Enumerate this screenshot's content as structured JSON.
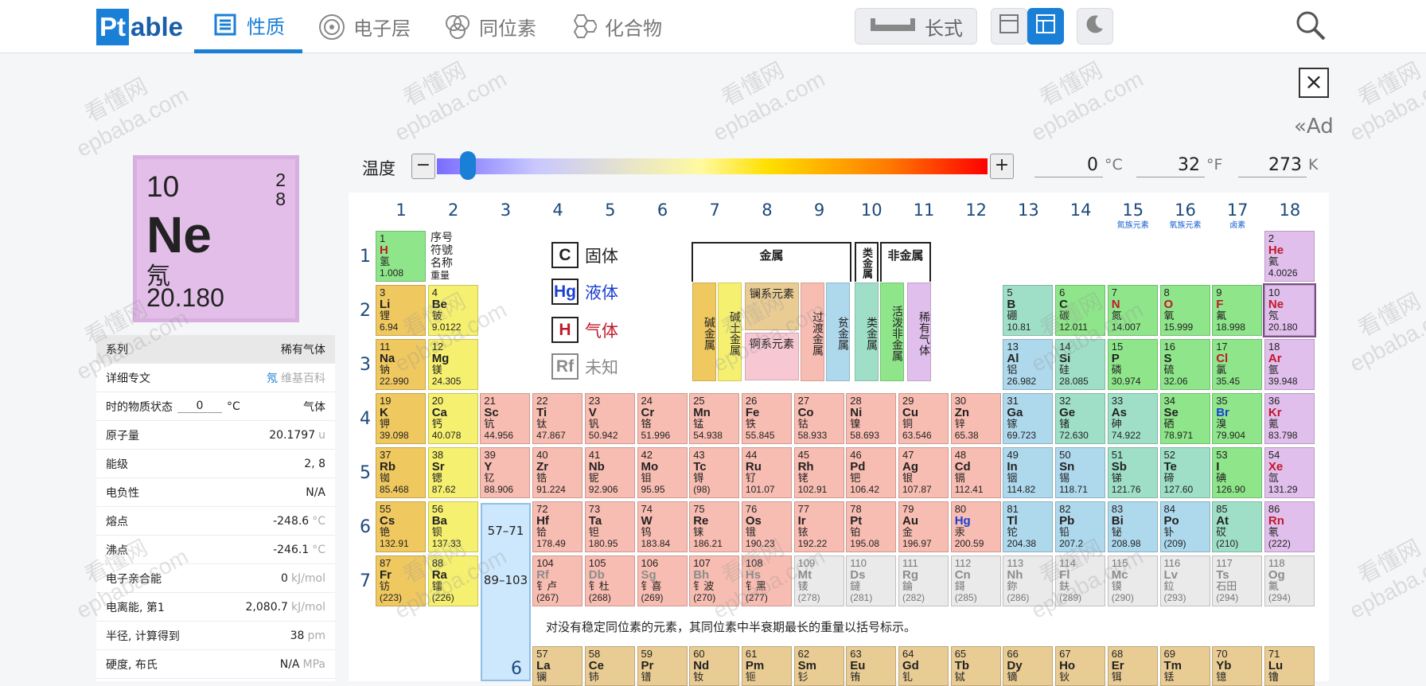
{
  "nav": {
    "logo_a": "Pt",
    "logo_b": "able",
    "tabs": [
      "性质",
      "电子层",
      "同位素",
      "化合物"
    ],
    "layout_label": "长式"
  },
  "ad": "«Ad",
  "card": {
    "number": "10",
    "shells": [
      "2",
      "8"
    ],
    "symbol": "Ne",
    "name": "氖",
    "mass": "20.180"
  },
  "props": [
    {
      "label": "系列",
      "value": "稀有气体",
      "hdr": true
    },
    {
      "label": "详细专文",
      "link": "氖",
      "value": "维基百科"
    },
    {
      "label": "时的物质状态",
      "temp": "0",
      "tunit": "°C",
      "value": "气体"
    },
    {
      "label": "原子量",
      "value": "20.1797",
      "unit": "u"
    },
    {
      "label": "能级",
      "value": "2, 8"
    },
    {
      "label": "电负性",
      "value": "N/A"
    },
    {
      "label": "熔点",
      "value": "-248.6",
      "unit": "°C"
    },
    {
      "label": "沸点",
      "value": "-246.1",
      "unit": "°C"
    },
    {
      "label": "电子亲合能",
      "value": "0",
      "unit": "kJ/mol"
    },
    {
      "label": "电离能, 第1",
      "value": "2,080.7",
      "unit": "kJ/mol"
    },
    {
      "label": "半径, 计算得到",
      "value": "38",
      "unit": "pm"
    },
    {
      "label": "硬度, 布氏",
      "value": "N/A",
      "unit": "MPa"
    }
  ],
  "temperature": {
    "label": "温度",
    "c": "0",
    "f": "32",
    "k": "273",
    "cu": "°C",
    "fu": "°F",
    "ku": "K"
  },
  "groups": [
    "1",
    "2",
    "3",
    "4",
    "5",
    "6",
    "7",
    "8",
    "9",
    "10",
    "11",
    "12",
    "13",
    "14",
    "15",
    "16",
    "17",
    "18"
  ],
  "group_sub": {
    "15": "氮族元素",
    "16": "氧族元素",
    "17": "卤素"
  },
  "periods": [
    "1",
    "2",
    "3",
    "4",
    "5",
    "6",
    "7"
  ],
  "key": [
    "序号",
    "符號",
    "名称",
    "重量"
  ],
  "legend": [
    {
      "sym": "C",
      "label": "固体"
    },
    {
      "sym": "Hg",
      "label": "液体"
    },
    {
      "sym": "H",
      "label": "气体"
    },
    {
      "sym": "Rf",
      "label": "未知"
    }
  ],
  "cat_headers": {
    "metal": "金属",
    "metalloid": "类金属",
    "nonmetal": "非金属"
  },
  "categories": [
    "碱金属",
    "碱土金属",
    "过渡金属",
    "贫金属",
    "类金属",
    "活泼非金属",
    "稀有气体"
  ],
  "lanth_label": "镧系元素",
  "actin_label": "锕系元素",
  "lanact": [
    "57–71",
    "89–103"
  ],
  "note": "对没有稳定同位素的元素，其同位素中半衰期最长的重量以括号标示。",
  "period6_label": "6",
  "watermark": [
    "看懂网",
    "epbaba.com"
  ],
  "elements": [
    [
      1,
      "H",
      "氢",
      "1.008",
      1,
      1,
      "nm",
      "g"
    ],
    [
      2,
      "He",
      "氦",
      "4.0026",
      18,
      1,
      "ng",
      "g"
    ],
    [
      3,
      "Li",
      "锂",
      "6.94",
      1,
      2,
      "alk",
      ""
    ],
    [
      4,
      "Be",
      "铍",
      "9.0122",
      2,
      2,
      "ae",
      ""
    ],
    [
      5,
      "B",
      "硼",
      "10.81",
      13,
      2,
      "met",
      ""
    ],
    [
      6,
      "C",
      "碳",
      "12.011",
      14,
      2,
      "nm",
      ""
    ],
    [
      7,
      "N",
      "氮",
      "14.007",
      15,
      2,
      "nm",
      "g"
    ],
    [
      8,
      "O",
      "氧",
      "15.999",
      16,
      2,
      "nm",
      "g"
    ],
    [
      9,
      "F",
      "氟",
      "18.998",
      17,
      2,
      "nm",
      "g"
    ],
    [
      10,
      "Ne",
      "氖",
      "20.180",
      18,
      2,
      "ng",
      "g"
    ],
    [
      11,
      "Na",
      "钠",
      "22.990",
      1,
      3,
      "alk",
      ""
    ],
    [
      12,
      "Mg",
      "镁",
      "24.305",
      2,
      3,
      "ae",
      ""
    ],
    [
      13,
      "Al",
      "铝",
      "26.982",
      13,
      3,
      "pt",
      ""
    ],
    [
      14,
      "Si",
      "硅",
      "28.085",
      14,
      3,
      "met",
      ""
    ],
    [
      15,
      "P",
      "磷",
      "30.974",
      15,
      3,
      "nm",
      ""
    ],
    [
      16,
      "S",
      "硫",
      "32.06",
      16,
      3,
      "nm",
      ""
    ],
    [
      17,
      "Cl",
      "氯",
      "35.45",
      17,
      3,
      "nm",
      "g"
    ],
    [
      18,
      "Ar",
      "氩",
      "39.948",
      18,
      3,
      "ng",
      "g"
    ],
    [
      19,
      "K",
      "钾",
      "39.098",
      1,
      4,
      "alk",
      ""
    ],
    [
      20,
      "Ca",
      "钙",
      "40.078",
      2,
      4,
      "ae",
      ""
    ],
    [
      21,
      "Sc",
      "钪",
      "44.956",
      3,
      4,
      "tm",
      ""
    ],
    [
      22,
      "Ti",
      "钛",
      "47.867",
      4,
      4,
      "tm",
      ""
    ],
    [
      23,
      "V",
      "钒",
      "50.942",
      5,
      4,
      "tm",
      ""
    ],
    [
      24,
      "Cr",
      "铬",
      "51.996",
      6,
      4,
      "tm",
      ""
    ],
    [
      25,
      "Mn",
      "锰",
      "54.938",
      7,
      4,
      "tm",
      ""
    ],
    [
      26,
      "Fe",
      "铁",
      "55.845",
      8,
      4,
      "tm",
      ""
    ],
    [
      27,
      "Co",
      "钴",
      "58.933",
      9,
      4,
      "tm",
      ""
    ],
    [
      28,
      "Ni",
      "镍",
      "58.693",
      10,
      4,
      "tm",
      ""
    ],
    [
      29,
      "Cu",
      "铜",
      "63.546",
      11,
      4,
      "tm",
      ""
    ],
    [
      30,
      "Zn",
      "锌",
      "65.38",
      12,
      4,
      "tm",
      ""
    ],
    [
      31,
      "Ga",
      "镓",
      "69.723",
      13,
      4,
      "pt",
      ""
    ],
    [
      32,
      "Ge",
      "锗",
      "72.630",
      14,
      4,
      "met",
      ""
    ],
    [
      33,
      "As",
      "砷",
      "74.922",
      15,
      4,
      "met",
      ""
    ],
    [
      34,
      "Se",
      "硒",
      "78.971",
      16,
      4,
      "nm",
      ""
    ],
    [
      35,
      "Br",
      "溴",
      "79.904",
      17,
      4,
      "nm",
      "l"
    ],
    [
      36,
      "Kr",
      "氪",
      "83.798",
      18,
      4,
      "ng",
      "g"
    ],
    [
      37,
      "Rb",
      "铷",
      "85.468",
      1,
      5,
      "alk",
      ""
    ],
    [
      38,
      "Sr",
      "锶",
      "87.62",
      2,
      5,
      "ae",
      ""
    ],
    [
      39,
      "Y",
      "钇",
      "88.906",
      3,
      5,
      "tm",
      ""
    ],
    [
      40,
      "Zr",
      "锆",
      "91.224",
      4,
      5,
      "tm",
      ""
    ],
    [
      41,
      "Nb",
      "铌",
      "92.906",
      5,
      5,
      "tm",
      ""
    ],
    [
      42,
      "Mo",
      "钼",
      "95.95",
      6,
      5,
      "tm",
      ""
    ],
    [
      43,
      "Tc",
      "锝",
      "(98)",
      7,
      5,
      "tm",
      ""
    ],
    [
      44,
      "Ru",
      "钌",
      "101.07",
      8,
      5,
      "tm",
      ""
    ],
    [
      45,
      "Rh",
      "铑",
      "102.91",
      9,
      5,
      "tm",
      ""
    ],
    [
      46,
      "Pd",
      "钯",
      "106.42",
      10,
      5,
      "tm",
      ""
    ],
    [
      47,
      "Ag",
      "银",
      "107.87",
      11,
      5,
      "tm",
      ""
    ],
    [
      48,
      "Cd",
      "镉",
      "112.41",
      12,
      5,
      "tm",
      ""
    ],
    [
      49,
      "In",
      "铟",
      "114.82",
      13,
      5,
      "pt",
      ""
    ],
    [
      50,
      "Sn",
      "锡",
      "118.71",
      14,
      5,
      "pt",
      ""
    ],
    [
      51,
      "Sb",
      "锑",
      "121.76",
      15,
      5,
      "met",
      ""
    ],
    [
      52,
      "Te",
      "碲",
      "127.60",
      16,
      5,
      "met",
      ""
    ],
    [
      53,
      "I",
      "碘",
      "126.90",
      17,
      5,
      "nm",
      ""
    ],
    [
      54,
      "Xe",
      "氙",
      "131.29",
      18,
      5,
      "ng",
      "g"
    ],
    [
      55,
      "Cs",
      "铯",
      "132.91",
      1,
      6,
      "alk",
      ""
    ],
    [
      56,
      "Ba",
      "钡",
      "137.33",
      2,
      6,
      "ae",
      ""
    ],
    [
      72,
      "Hf",
      "铪",
      "178.49",
      4,
      6,
      "tm",
      ""
    ],
    [
      73,
      "Ta",
      "钽",
      "180.95",
      5,
      6,
      "tm",
      ""
    ],
    [
      74,
      "W",
      "钨",
      "183.84",
      6,
      6,
      "tm",
      ""
    ],
    [
      75,
      "Re",
      "铼",
      "186.21",
      7,
      6,
      "tm",
      ""
    ],
    [
      76,
      "Os",
      "锇",
      "190.23",
      8,
      6,
      "tm",
      ""
    ],
    [
      77,
      "Ir",
      "铱",
      "192.22",
      9,
      6,
      "tm",
      ""
    ],
    [
      78,
      "Pt",
      "铂",
      "195.08",
      10,
      6,
      "tm",
      ""
    ],
    [
      79,
      "Au",
      "金",
      "196.97",
      11,
      6,
      "tm",
      ""
    ],
    [
      80,
      "Hg",
      "汞",
      "200.59",
      12,
      6,
      "tm",
      "l"
    ],
    [
      81,
      "Tl",
      "铊",
      "204.38",
      13,
      6,
      "pt",
      ""
    ],
    [
      82,
      "Pb",
      "铅",
      "207.2",
      14,
      6,
      "pt",
      ""
    ],
    [
      83,
      "Bi",
      "铋",
      "208.98",
      15,
      6,
      "pt",
      ""
    ],
    [
      84,
      "Po",
      "钋",
      "(209)",
      16,
      6,
      "pt",
      ""
    ],
    [
      85,
      "At",
      "砹",
      "(210)",
      17,
      6,
      "met",
      ""
    ],
    [
      86,
      "Rn",
      "氡",
      "(222)",
      18,
      6,
      "ng",
      "g"
    ],
    [
      87,
      "Fr",
      "钫",
      "(223)",
      1,
      7,
      "alk",
      ""
    ],
    [
      88,
      "Ra",
      "镭",
      "(226)",
      2,
      7,
      "ae",
      ""
    ],
    [
      104,
      "Rf",
      "钅卢",
      "(267)",
      4,
      7,
      "tm",
      "u"
    ],
    [
      105,
      "Db",
      "钅杜",
      "(268)",
      5,
      7,
      "tm",
      "u"
    ],
    [
      106,
      "Sg",
      "钅喜",
      "(269)",
      6,
      7,
      "tm",
      "u"
    ],
    [
      107,
      "Bh",
      "钅波",
      "(270)",
      7,
      7,
      "tm",
      "u"
    ],
    [
      108,
      "Hs",
      "钅黑",
      "(277)",
      8,
      7,
      "tm",
      "u"
    ],
    [
      109,
      "Mt",
      "鿏",
      "(278)",
      9,
      7,
      "unk",
      "u"
    ],
    [
      110,
      "Ds",
      "鐽",
      "(281)",
      10,
      7,
      "unk",
      "u"
    ],
    [
      111,
      "Rg",
      "錀",
      "(282)",
      11,
      7,
      "unk",
      "u"
    ],
    [
      112,
      "Cn",
      "鎶",
      "(285)",
      12,
      7,
      "unk",
      "u"
    ],
    [
      113,
      "Nh",
      "鉨",
      "(286)",
      13,
      7,
      "unk",
      "u"
    ],
    [
      114,
      "Fl",
      "鈇",
      "(289)",
      14,
      7,
      "unk",
      "u"
    ],
    [
      115,
      "Mc",
      "镆",
      "(290)",
      15,
      7,
      "unk",
      "u"
    ],
    [
      116,
      "Lv",
      "鉝",
      "(293)",
      16,
      7,
      "unk",
      "u"
    ],
    [
      117,
      "Ts",
      "石田",
      "(294)",
      17,
      7,
      "unk",
      "u"
    ],
    [
      118,
      "Og",
      "鿫",
      "(294)",
      18,
      7,
      "unk",
      "u"
    ],
    [
      57,
      "La",
      "镧",
      "",
      4,
      9,
      "la",
      ""
    ],
    [
      58,
      "Ce",
      "铈",
      "",
      5,
      9,
      "la",
      ""
    ],
    [
      59,
      "Pr",
      "镨",
      "",
      6,
      9,
      "la",
      ""
    ],
    [
      60,
      "Nd",
      "钕",
      "",
      7,
      9,
      "la",
      ""
    ],
    [
      61,
      "Pm",
      "钷",
      "",
      8,
      9,
      "la",
      ""
    ],
    [
      62,
      "Sm",
      "钐",
      "",
      9,
      9,
      "la",
      ""
    ],
    [
      63,
      "Eu",
      "铕",
      "",
      10,
      9,
      "la",
      ""
    ],
    [
      64,
      "Gd",
      "钆",
      "",
      11,
      9,
      "la",
      ""
    ],
    [
      65,
      "Tb",
      "铽",
      "",
      12,
      9,
      "la",
      ""
    ],
    [
      66,
      "Dy",
      "镝",
      "",
      13,
      9,
      "la",
      ""
    ],
    [
      67,
      "Ho",
      "钬",
      "",
      14,
      9,
      "la",
      ""
    ],
    [
      68,
      "Er",
      "铒",
      "",
      15,
      9,
      "la",
      ""
    ],
    [
      69,
      "Tm",
      "铥",
      "",
      16,
      9,
      "la",
      ""
    ],
    [
      70,
      "Yb",
      "镱",
      "",
      17,
      9,
      "la",
      ""
    ],
    [
      71,
      "Lu",
      "镥",
      "",
      18,
      9,
      "la",
      ""
    ]
  ]
}
